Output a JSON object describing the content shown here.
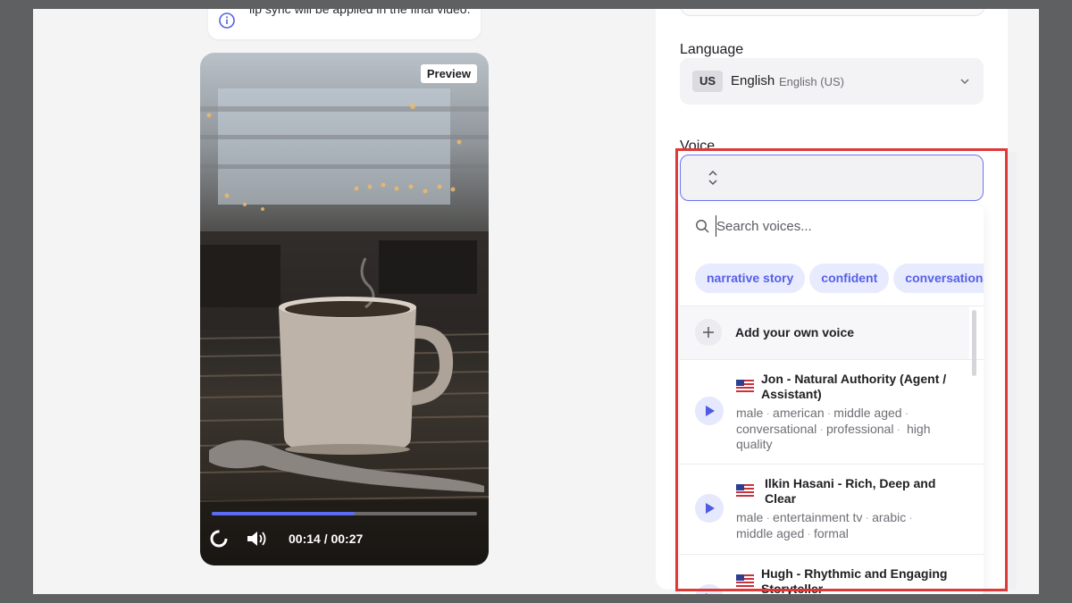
{
  "notice": {
    "icon": "info-icon",
    "text": "lip sync will be applied in the final video."
  },
  "video": {
    "preview_label": "Preview",
    "time": "00:14 / 00:27",
    "progress": 0.54,
    "controls": [
      "loading-icon",
      "volume-icon"
    ]
  },
  "settings": {
    "language_label": "Language",
    "language": {
      "code": "US",
      "name": "English",
      "sub": "English (US)"
    },
    "voice_label": "Voice"
  },
  "voice_dropdown": {
    "search_placeholder": "Search voices...",
    "chips": [
      "narrative story",
      "confident",
      "conversational"
    ],
    "add_voice_label": "Add your own voice",
    "voices": [
      {
        "name": "Jon - Natural Authority (Agent / Assistant)",
        "flag": "us-flag-icon",
        "tags": [
          "male",
          "american",
          "middle aged",
          "conversational",
          "professional",
          "high quality"
        ]
      },
      {
        "name": "Ilkin Hasani - Rich, Deep and Clear",
        "flag": "us-flag-icon",
        "tags": [
          "male",
          "entertainment tv",
          "arabic",
          "middle aged",
          "formal"
        ]
      },
      {
        "name": "Hugh - Rhythmic and Engaging Storyteller",
        "flag": "us-flag-icon",
        "tags": []
      }
    ]
  },
  "colors": {
    "accent": "#5b6cf2",
    "chip_bg": "#e8eafe",
    "highlight": "#e03838"
  }
}
